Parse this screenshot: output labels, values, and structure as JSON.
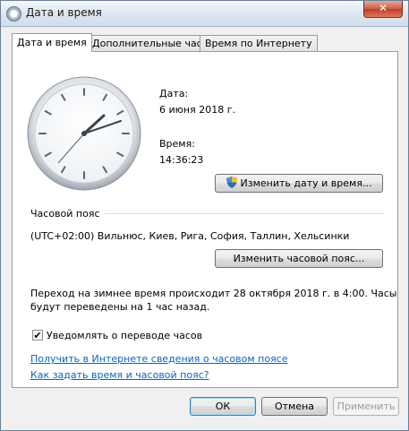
{
  "window": {
    "title": "Дата и время",
    "close_glyph": "✕"
  },
  "tabs": [
    {
      "label": "Дата и время",
      "active": true
    },
    {
      "label": "Дополнительные часы",
      "active": false
    },
    {
      "label": "Время по Интернету",
      "active": false
    }
  ],
  "datetime": {
    "date_label": "Дата:",
    "date_value": "6 июня 2018 г.",
    "time_label": "Время:",
    "time_value": "14:36:23",
    "change_button": "Изменить дату и время..."
  },
  "timezone": {
    "section_label": "Часовой пояс",
    "value": "(UTC+02:00) Вильнюс, Киев, Рига, София, Таллин, Хельсинки",
    "change_button": "Изменить часовой пояс..."
  },
  "dst": {
    "info_line1": "Переход на зимнее время происходит 28 октября 2018 г. в 4:00. Часы",
    "info_line2": "будут переведены на 1 час назад.",
    "notify_label": "Уведомлять о переводе часов",
    "notify_checked": true
  },
  "links": {
    "online_info": "Получить в Интернете сведения о часовом поясе",
    "how_to": "Как задать время и часовой пояс?"
  },
  "footer": {
    "ok": "ОК",
    "cancel": "Отмена",
    "apply": "Применить"
  },
  "icons": {
    "shield": "uac-shield-icon",
    "clock": "analog-clock-icon"
  },
  "colors": {
    "link": "#0066cc",
    "close": "#c03b25"
  }
}
